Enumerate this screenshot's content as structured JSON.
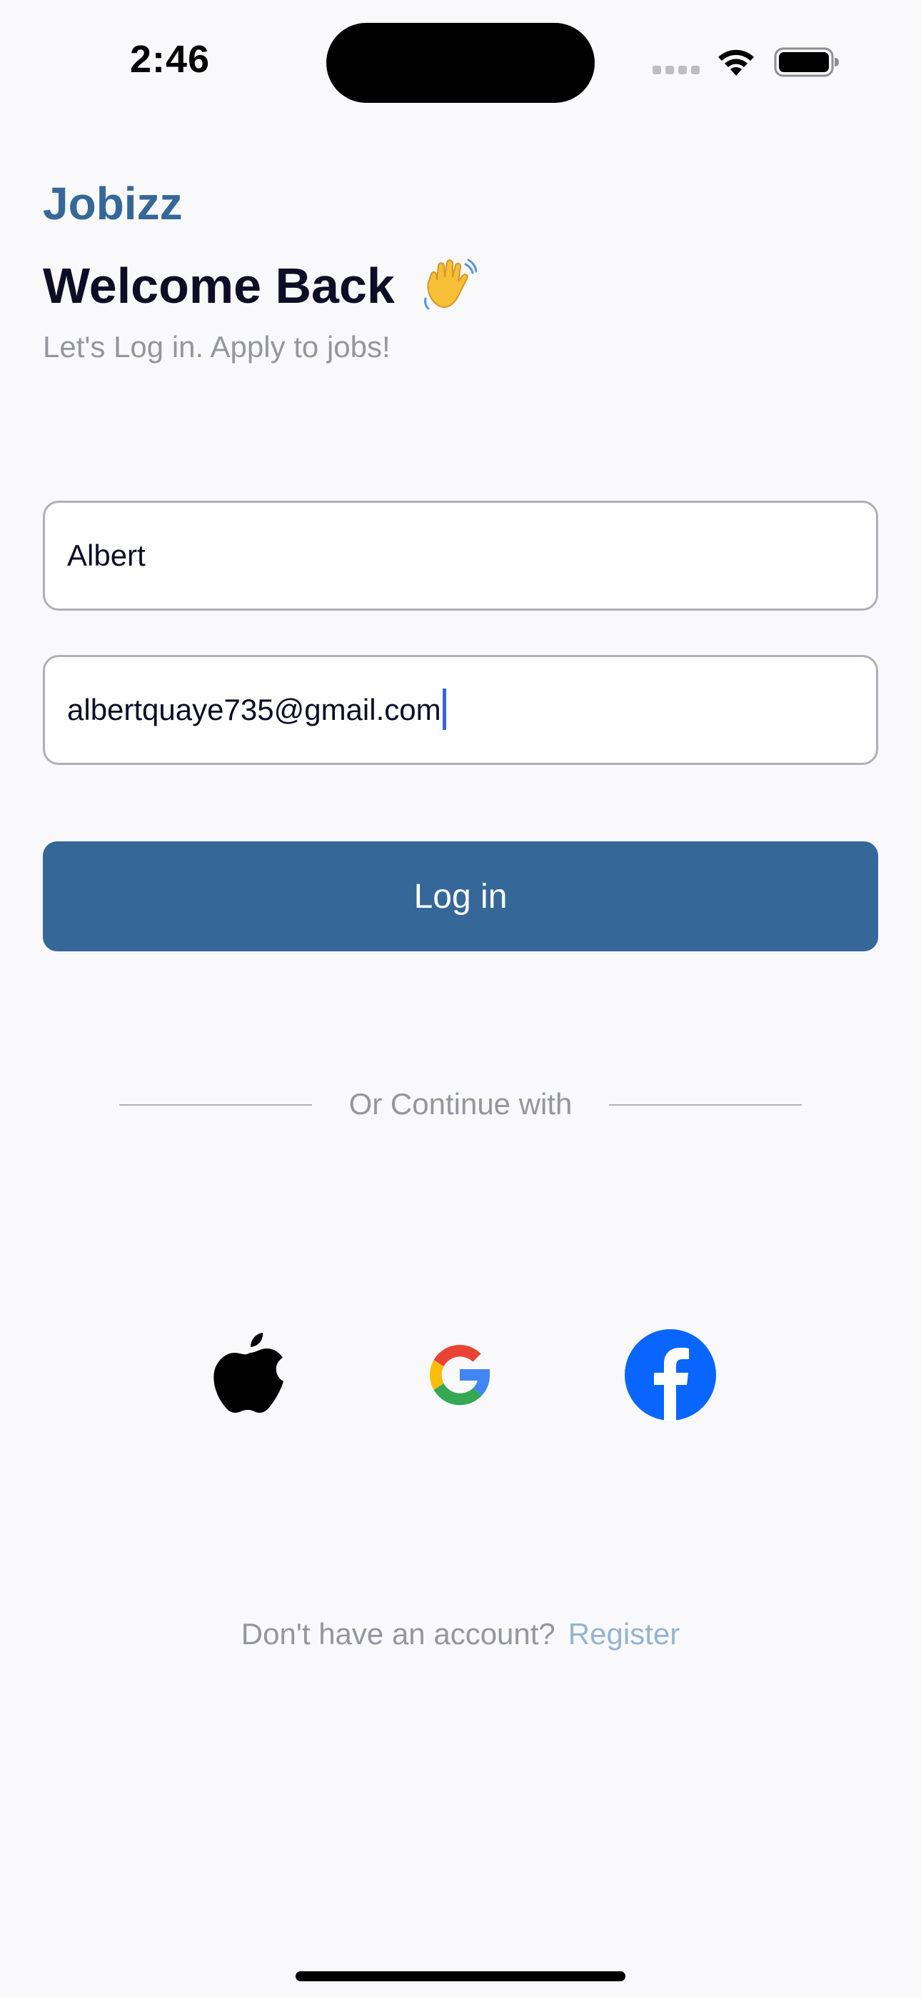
{
  "status_bar": {
    "time": "2:46",
    "icons": [
      "cellular-signal-icon",
      "wifi-icon",
      "battery-icon"
    ]
  },
  "header": {
    "brand": "Jobizz",
    "title": "Welcome Back",
    "title_emoji": "waving-hand-icon",
    "subtitle": "Let's Log in. Apply to jobs!"
  },
  "form": {
    "name_value": "Albert",
    "email_value": "albertquaye735@gmail.com",
    "login_label": "Log in"
  },
  "divider": {
    "text": "Or Continue with"
  },
  "social": [
    {
      "name": "apple-icon"
    },
    {
      "name": "google-icon"
    },
    {
      "name": "facebook-icon"
    }
  ],
  "footer": {
    "prompt": "Don't have an account?",
    "register_label": "Register"
  },
  "colors": {
    "brand": "#356899",
    "button_bg": "#356899",
    "link": "#95B4D1",
    "muted_text": "#95969D",
    "background": "#F9F9FB"
  }
}
